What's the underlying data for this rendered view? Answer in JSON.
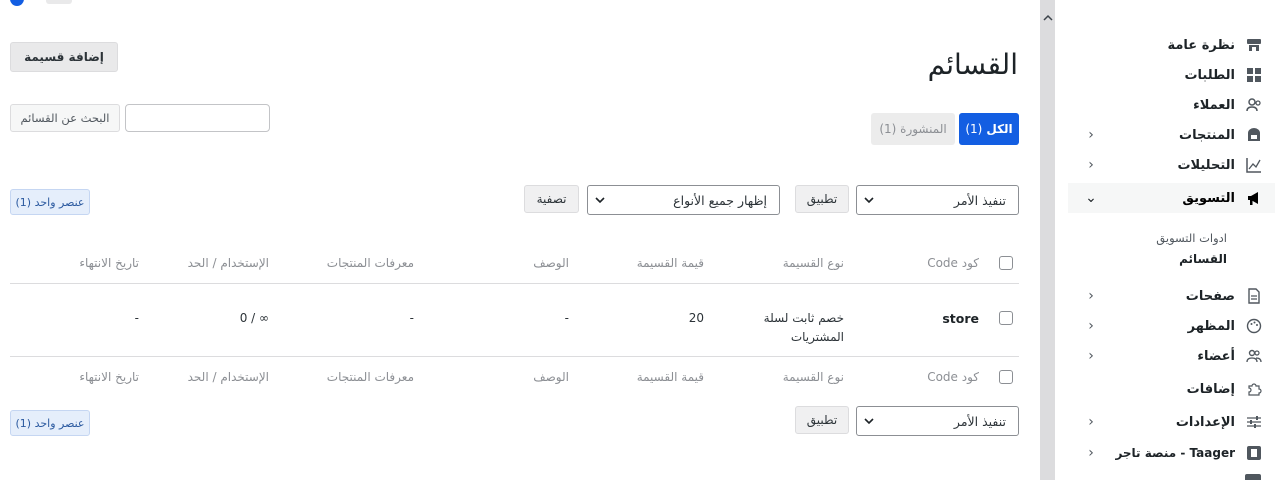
{
  "sidebar": {
    "items": [
      {
        "label": "نظرة عامة",
        "icon": "store-icon",
        "chevron": ""
      },
      {
        "label": "الطلبات",
        "icon": "grid-icon",
        "chevron": ""
      },
      {
        "label": "العملاء",
        "icon": "users-icon",
        "chevron": ""
      },
      {
        "label": "المنتجات",
        "icon": "box-icon",
        "chevron": "‹"
      },
      {
        "label": "التحليلات",
        "icon": "chart-icon",
        "chevron": "‹"
      },
      {
        "label": "التسويق",
        "icon": "megaphone-icon",
        "chevron": "⌄"
      },
      {
        "label": "صفحات",
        "icon": "page-icon",
        "chevron": "‹"
      },
      {
        "label": "المظهر",
        "icon": "palette-icon",
        "chevron": "‹"
      },
      {
        "label": "أعضاء",
        "icon": "members-icon",
        "chevron": "‹"
      },
      {
        "label": "إضافات",
        "icon": "puzzle-icon",
        "chevron": ""
      },
      {
        "label": "الإعدادات",
        "icon": "sliders-icon",
        "chevron": "‹"
      },
      {
        "label": "Taager - منصة تاجر",
        "icon": "taager-icon",
        "chevron": "‹"
      }
    ],
    "sub_items": [
      "ادوات التسويق",
      "القسائم"
    ]
  },
  "main": {
    "title": "القسائم",
    "add_button": "إضافة قسيمة",
    "tabs": {
      "all_label": "الكل",
      "all_count": "(1)",
      "published_label": "المنشورة (1)"
    },
    "search_button": "البحث عن القسائم",
    "bulk_action": "تنفيذ الأمر",
    "apply": "تطبيق",
    "type_filter": "إظهار جميع الأنواع",
    "filter_button": "تصفية",
    "item_count": "عنصر واحد (1)",
    "columns": {
      "code": "كود Code",
      "type": "نوع القسيمة",
      "value": "قيمة القسيمة",
      "description": "الوصف",
      "products": "معرفات المنتجات",
      "usage": "الإستخدام / الحد",
      "expiry": "تاريخ الانتهاء"
    },
    "rows": [
      {
        "code": "store",
        "type": "خصم ثابت لسلة المشتريات",
        "value": "20",
        "description": "-",
        "products": "-",
        "usage": "0 / ∞",
        "expiry": "-"
      }
    ]
  },
  "colors": {
    "accent": "#135ee2",
    "badge_bg": "#e5eefb"
  }
}
